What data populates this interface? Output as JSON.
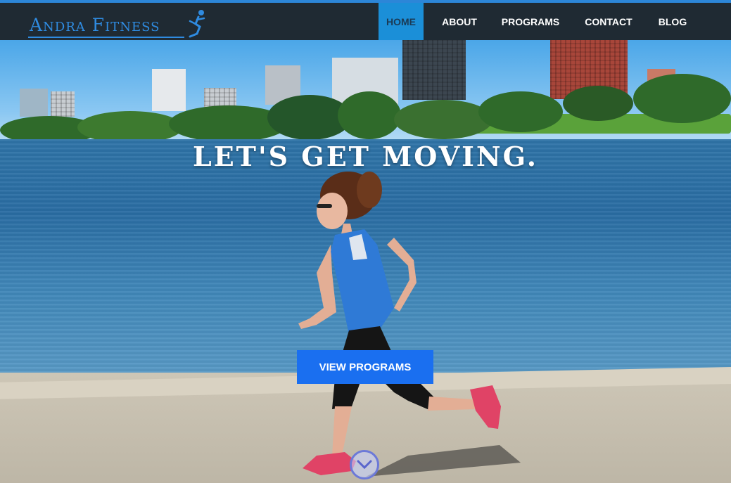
{
  "brand": {
    "name": "Andra Fitness"
  },
  "nav": {
    "items": [
      {
        "label": "HOME",
        "active": true
      },
      {
        "label": "ABOUT",
        "active": false
      },
      {
        "label": "PROGRAMS",
        "active": false
      },
      {
        "label": "CONTACT",
        "active": false
      },
      {
        "label": "BLOG",
        "active": false
      }
    ]
  },
  "hero": {
    "headline": "LET'S GET MOVING.",
    "cta_label": "VIEW PROGRAMS",
    "scroll_icon": "chevron-down-icon"
  },
  "colors": {
    "navbar_bg": "#1f2a33",
    "accent": "#1b8fd8",
    "logo_blue": "#2f8be0",
    "cta_blue": "#1a6ff0"
  }
}
